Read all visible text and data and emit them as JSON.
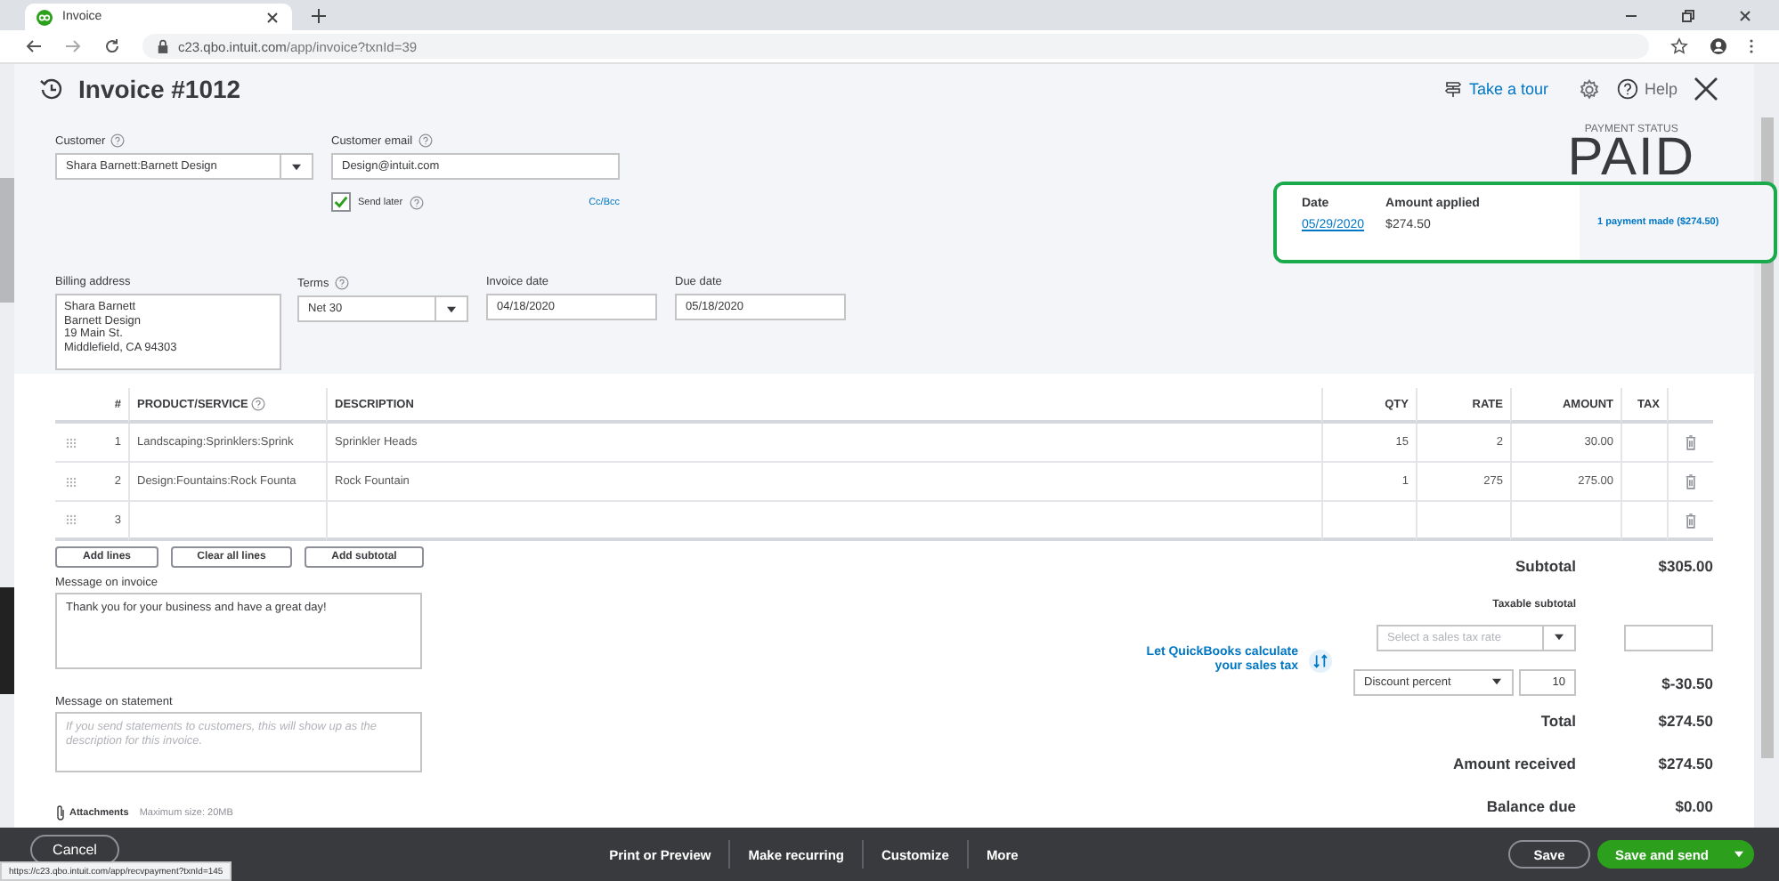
{
  "browser": {
    "tab_title": "Invoice",
    "url_host": "c23.qbo.intuit.com",
    "url_path": "/app/invoice?txnId=39"
  },
  "header": {
    "title": "Invoice #1012",
    "tour_link": "Take a tour",
    "help": "Help"
  },
  "customer": {
    "label": "Customer",
    "value": "Shara Barnett:Barnett Design"
  },
  "customer_email": {
    "label": "Customer email",
    "value": "Design@intuit.com",
    "cc_bcc": "Cc/Bcc"
  },
  "send_later": {
    "label": "Send later",
    "checked": true
  },
  "billing_address": {
    "label": "Billing address",
    "lines": [
      "Shara Barnett",
      "Barnett Design",
      "19 Main St.",
      "Middlefield, CA  94303"
    ]
  },
  "terms": {
    "label": "Terms",
    "value": "Net 30"
  },
  "invoice_date": {
    "label": "Invoice date",
    "value": "04/18/2020"
  },
  "due_date": {
    "label": "Due date",
    "value": "05/18/2020"
  },
  "payment_status": {
    "label": "PAYMENT STATUS",
    "value": "PAID"
  },
  "payment_popup": {
    "date_label": "Date",
    "amount_label": "Amount applied",
    "date": "05/29/2020",
    "amount": "$274.50",
    "summary_link": "1 payment made ($274.50)"
  },
  "table": {
    "columns": [
      "#",
      "PRODUCT/SERVICE",
      "DESCRIPTION",
      "QTY",
      "RATE",
      "AMOUNT",
      "TAX"
    ],
    "rows": [
      {
        "number": "1",
        "product": "Landscaping:Sprinklers:Sprink",
        "description": "Sprinkler Heads",
        "qty": "15",
        "rate": "2",
        "amount": "30.00"
      },
      {
        "number": "2",
        "product": "Design:Fountains:Rock Founta",
        "description": "Rock Fountain",
        "qty": "1",
        "rate": "275",
        "amount": "275.00"
      },
      {
        "number": "3",
        "product": "",
        "description": "",
        "qty": "",
        "rate": "",
        "amount": ""
      }
    ]
  },
  "table_buttons": [
    "Add lines",
    "Clear all lines",
    "Add subtotal"
  ],
  "message_on_invoice": {
    "label": "Message on invoice",
    "value": "Thank you for your business and have a great day!"
  },
  "message_on_statement": {
    "label": "Message on statement",
    "placeholder": "If you send statements to customers, this will show up as the description for this invoice."
  },
  "attachments": {
    "label": "Attachments",
    "note": "Maximum size: 20MB"
  },
  "subtotal": {
    "label": "Subtotal",
    "value": "$305.00"
  },
  "tax": {
    "taxable_label": "Taxable subtotal",
    "rate_placeholder": "Select a sales tax rate",
    "link": "Let QuickBooks calculate your sales tax"
  },
  "discount": {
    "type": "Discount percent",
    "value": "10",
    "amount": "$-30.50"
  },
  "totals": [
    {
      "label": "Total",
      "value": "$274.50"
    },
    {
      "label": "Amount received",
      "value": "$274.50"
    },
    {
      "label": "Balance due",
      "value": "$0.00"
    }
  ],
  "footer": {
    "cancel": "Cancel",
    "actions": [
      "Print or Preview",
      "Make recurring",
      "Customize",
      "More"
    ],
    "save": "Save",
    "save_and_send": "Save and send"
  },
  "status_url": "https://c23.qbo.intuit.com/app/recvpayment?txnId=145"
}
